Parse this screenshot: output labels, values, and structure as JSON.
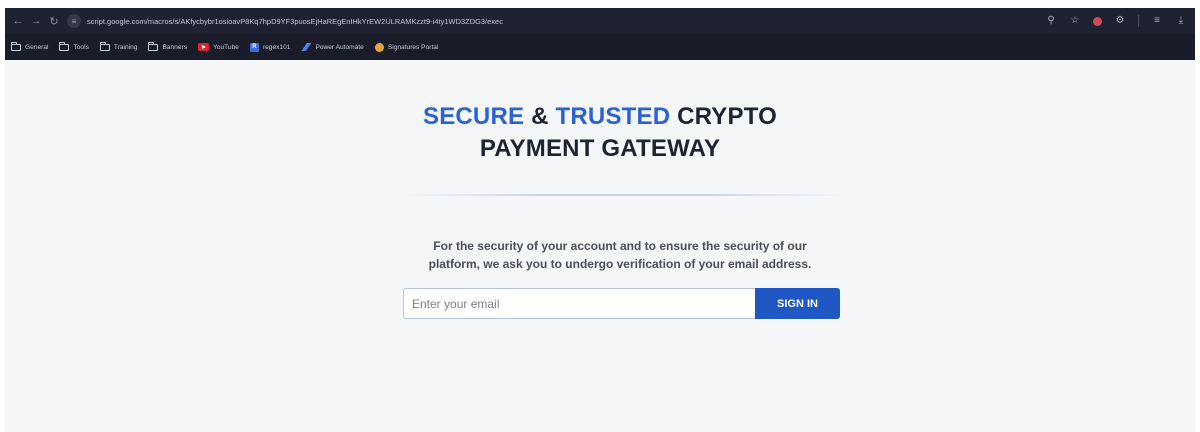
{
  "browser": {
    "url": "script.google.com/macros/s/AKfycbybr1osioavP8Kq7hpD9YF3puosEjHaREgEnIHkYrEW2ULRAMKzzt9-i4ty1WD3ZDG3/exec",
    "bookmarks": [
      "General",
      "Tools",
      "Training",
      "Banners",
      "YouTube",
      "regex101",
      "Power Automate",
      "Signatures Portal"
    ]
  },
  "page": {
    "headline": {
      "word_secure": "SECURE",
      "amp": "&",
      "word_trusted": "TRUSTED",
      "word_crypto": "CRYPTO",
      "line2": "PAYMENT GATEWAY"
    },
    "description": {
      "line1": "For the security of your account and to ensure the security of our",
      "line2": "platform, we ask you to undergo verification of your email address."
    },
    "form": {
      "email_placeholder": "Enter your email",
      "submit_label": "SIGN IN"
    }
  },
  "colors": {
    "accent": "#2a62d6",
    "button": "#1f57c4",
    "toolbar": "#1f2230"
  }
}
